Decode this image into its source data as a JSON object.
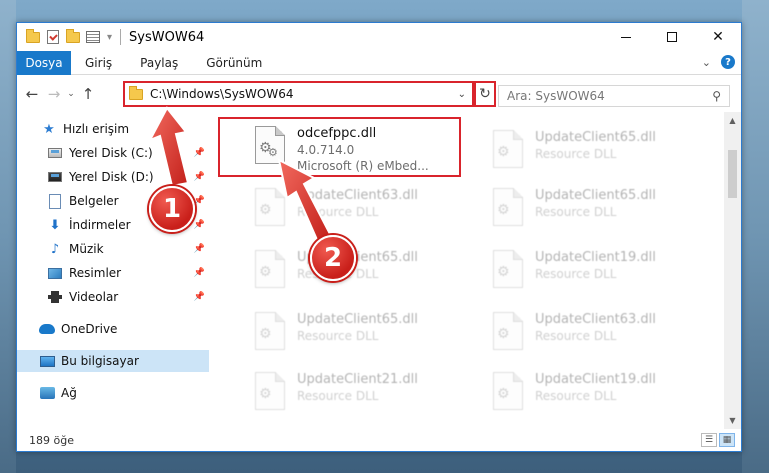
{
  "window": {
    "title": "SysWOW64",
    "minimize": "",
    "maximize": "",
    "close": "✕"
  },
  "ribbon": {
    "file_tab": "Dosya",
    "tabs": [
      "Giriş",
      "Paylaş",
      "Görünüm"
    ]
  },
  "nav": {
    "back": "←",
    "forward": "→",
    "recent": "⌄",
    "up": "↑",
    "address": "C:\\Windows\\SysWOW64",
    "refresh": "↻",
    "search_placeholder": "Ara: SysWOW64"
  },
  "sidebar": {
    "items": [
      {
        "label": "Hızlı erişim"
      },
      {
        "label": "Yerel Disk (C:)"
      },
      {
        "label": "Yerel Disk (D:)"
      },
      {
        "label": "Belgeler"
      },
      {
        "label": "İndirmeler"
      },
      {
        "label": "Müzik"
      },
      {
        "label": "Resimler"
      },
      {
        "label": "Videolar"
      },
      {
        "label": "OneDrive"
      },
      {
        "label": "Bu bilgisayar"
      },
      {
        "label": "Ağ"
      }
    ]
  },
  "files": {
    "main": {
      "name": "odcefppc.dll",
      "version": "4.0.714.0",
      "description": "Microsoft (R) eMbed..."
    },
    "faded": [
      {
        "name": "UpdateClient65.dll",
        "type": "Resource DLL"
      },
      {
        "name": "UpdateClient63.dll",
        "type": "Resource DLL"
      },
      {
        "name": "UpdateClient65.dll",
        "type": "Resource DLL"
      },
      {
        "name": "UpdateClient65.dll",
        "type": "Resource DLL"
      },
      {
        "name": "UpdateClient19.dll",
        "type": "Resource DLL"
      },
      {
        "name": "UpdateClient65.dll",
        "type": "Resource DLL"
      },
      {
        "name": "UpdateClient63.dll",
        "type": "Resource DLL"
      },
      {
        "name": "UpdateClient21.dll",
        "type": "Resource DLL"
      },
      {
        "name": "UpdateClient19.dll",
        "type": "Resource DLL"
      }
    ]
  },
  "status": {
    "count": "189 öğe"
  },
  "callouts": [
    "1",
    "2"
  ],
  "colors": {
    "accent": "#1979ca",
    "highlight": "#d9242c",
    "selection": "#cce4f7"
  }
}
